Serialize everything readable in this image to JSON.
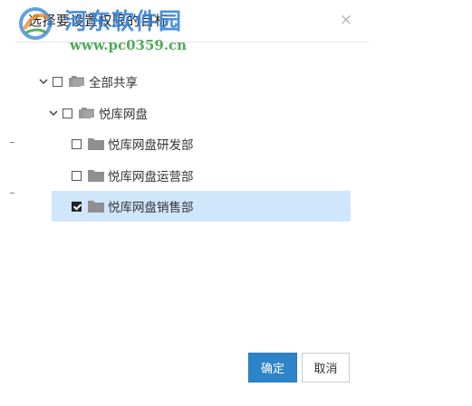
{
  "dialog": {
    "title": "选择要设置权限的目标",
    "close_symbol": "×"
  },
  "watermark": {
    "name": "河东软件园",
    "url": "www.pc0359.cn"
  },
  "tree": {
    "nodes": [
      {
        "label": "全部共享",
        "checked": false,
        "expanded": true,
        "icon": "multi-folder-icon"
      },
      {
        "label": "悦库网盘",
        "checked": false,
        "expanded": true,
        "icon": "multi-folder-icon"
      },
      {
        "label": "悦库网盘研发部",
        "checked": false,
        "icon": "folder-icon"
      },
      {
        "label": "悦库网盘运营部",
        "checked": false,
        "icon": "folder-icon"
      },
      {
        "label": "悦库网盘销售部",
        "checked": true,
        "selected": true,
        "icon": "folder-icon"
      }
    ]
  },
  "buttons": {
    "ok_label": "确定",
    "cancel_label": "取消"
  },
  "colors": {
    "primary": "#2d84c9",
    "selected_row": "#cfe6fb",
    "folder_gray": "#8f8f8f"
  }
}
